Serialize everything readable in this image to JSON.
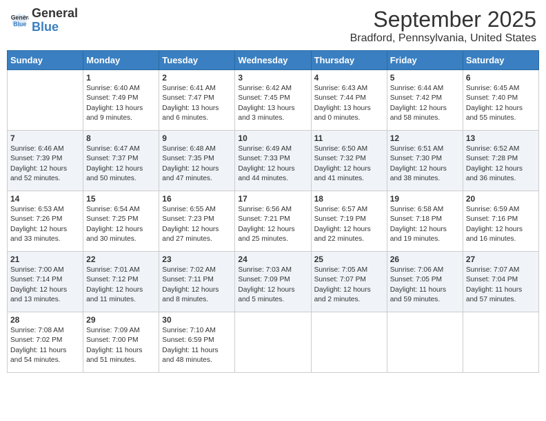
{
  "logo": {
    "line1": "General",
    "line2": "Blue"
  },
  "title": "September 2025",
  "location": "Bradford, Pennsylvania, United States",
  "days_of_week": [
    "Sunday",
    "Monday",
    "Tuesday",
    "Wednesday",
    "Thursday",
    "Friday",
    "Saturday"
  ],
  "weeks": [
    [
      {
        "day": "",
        "sunrise": "",
        "sunset": "",
        "daylight": ""
      },
      {
        "day": "1",
        "sunrise": "Sunrise: 6:40 AM",
        "sunset": "Sunset: 7:49 PM",
        "daylight": "Daylight: 13 hours and 9 minutes."
      },
      {
        "day": "2",
        "sunrise": "Sunrise: 6:41 AM",
        "sunset": "Sunset: 7:47 PM",
        "daylight": "Daylight: 13 hours and 6 minutes."
      },
      {
        "day": "3",
        "sunrise": "Sunrise: 6:42 AM",
        "sunset": "Sunset: 7:45 PM",
        "daylight": "Daylight: 13 hours and 3 minutes."
      },
      {
        "day": "4",
        "sunrise": "Sunrise: 6:43 AM",
        "sunset": "Sunset: 7:44 PM",
        "daylight": "Daylight: 13 hours and 0 minutes."
      },
      {
        "day": "5",
        "sunrise": "Sunrise: 6:44 AM",
        "sunset": "Sunset: 7:42 PM",
        "daylight": "Daylight: 12 hours and 58 minutes."
      },
      {
        "day": "6",
        "sunrise": "Sunrise: 6:45 AM",
        "sunset": "Sunset: 7:40 PM",
        "daylight": "Daylight: 12 hours and 55 minutes."
      }
    ],
    [
      {
        "day": "7",
        "sunrise": "Sunrise: 6:46 AM",
        "sunset": "Sunset: 7:39 PM",
        "daylight": "Daylight: 12 hours and 52 minutes."
      },
      {
        "day": "8",
        "sunrise": "Sunrise: 6:47 AM",
        "sunset": "Sunset: 7:37 PM",
        "daylight": "Daylight: 12 hours and 50 minutes."
      },
      {
        "day": "9",
        "sunrise": "Sunrise: 6:48 AM",
        "sunset": "Sunset: 7:35 PM",
        "daylight": "Daylight: 12 hours and 47 minutes."
      },
      {
        "day": "10",
        "sunrise": "Sunrise: 6:49 AM",
        "sunset": "Sunset: 7:33 PM",
        "daylight": "Daylight: 12 hours and 44 minutes."
      },
      {
        "day": "11",
        "sunrise": "Sunrise: 6:50 AM",
        "sunset": "Sunset: 7:32 PM",
        "daylight": "Daylight: 12 hours and 41 minutes."
      },
      {
        "day": "12",
        "sunrise": "Sunrise: 6:51 AM",
        "sunset": "Sunset: 7:30 PM",
        "daylight": "Daylight: 12 hours and 38 minutes."
      },
      {
        "day": "13",
        "sunrise": "Sunrise: 6:52 AM",
        "sunset": "Sunset: 7:28 PM",
        "daylight": "Daylight: 12 hours and 36 minutes."
      }
    ],
    [
      {
        "day": "14",
        "sunrise": "Sunrise: 6:53 AM",
        "sunset": "Sunset: 7:26 PM",
        "daylight": "Daylight: 12 hours and 33 minutes."
      },
      {
        "day": "15",
        "sunrise": "Sunrise: 6:54 AM",
        "sunset": "Sunset: 7:25 PM",
        "daylight": "Daylight: 12 hours and 30 minutes."
      },
      {
        "day": "16",
        "sunrise": "Sunrise: 6:55 AM",
        "sunset": "Sunset: 7:23 PM",
        "daylight": "Daylight: 12 hours and 27 minutes."
      },
      {
        "day": "17",
        "sunrise": "Sunrise: 6:56 AM",
        "sunset": "Sunset: 7:21 PM",
        "daylight": "Daylight: 12 hours and 25 minutes."
      },
      {
        "day": "18",
        "sunrise": "Sunrise: 6:57 AM",
        "sunset": "Sunset: 7:19 PM",
        "daylight": "Daylight: 12 hours and 22 minutes."
      },
      {
        "day": "19",
        "sunrise": "Sunrise: 6:58 AM",
        "sunset": "Sunset: 7:18 PM",
        "daylight": "Daylight: 12 hours and 19 minutes."
      },
      {
        "day": "20",
        "sunrise": "Sunrise: 6:59 AM",
        "sunset": "Sunset: 7:16 PM",
        "daylight": "Daylight: 12 hours and 16 minutes."
      }
    ],
    [
      {
        "day": "21",
        "sunrise": "Sunrise: 7:00 AM",
        "sunset": "Sunset: 7:14 PM",
        "daylight": "Daylight: 12 hours and 13 minutes."
      },
      {
        "day": "22",
        "sunrise": "Sunrise: 7:01 AM",
        "sunset": "Sunset: 7:12 PM",
        "daylight": "Daylight: 12 hours and 11 minutes."
      },
      {
        "day": "23",
        "sunrise": "Sunrise: 7:02 AM",
        "sunset": "Sunset: 7:11 PM",
        "daylight": "Daylight: 12 hours and 8 minutes."
      },
      {
        "day": "24",
        "sunrise": "Sunrise: 7:03 AM",
        "sunset": "Sunset: 7:09 PM",
        "daylight": "Daylight: 12 hours and 5 minutes."
      },
      {
        "day": "25",
        "sunrise": "Sunrise: 7:05 AM",
        "sunset": "Sunset: 7:07 PM",
        "daylight": "Daylight: 12 hours and 2 minutes."
      },
      {
        "day": "26",
        "sunrise": "Sunrise: 7:06 AM",
        "sunset": "Sunset: 7:05 PM",
        "daylight": "Daylight: 11 hours and 59 minutes."
      },
      {
        "day": "27",
        "sunrise": "Sunrise: 7:07 AM",
        "sunset": "Sunset: 7:04 PM",
        "daylight": "Daylight: 11 hours and 57 minutes."
      }
    ],
    [
      {
        "day": "28",
        "sunrise": "Sunrise: 7:08 AM",
        "sunset": "Sunset: 7:02 PM",
        "daylight": "Daylight: 11 hours and 54 minutes."
      },
      {
        "day": "29",
        "sunrise": "Sunrise: 7:09 AM",
        "sunset": "Sunset: 7:00 PM",
        "daylight": "Daylight: 11 hours and 51 minutes."
      },
      {
        "day": "30",
        "sunrise": "Sunrise: 7:10 AM",
        "sunset": "Sunset: 6:59 PM",
        "daylight": "Daylight: 11 hours and 48 minutes."
      },
      {
        "day": "",
        "sunrise": "",
        "sunset": "",
        "daylight": ""
      },
      {
        "day": "",
        "sunrise": "",
        "sunset": "",
        "daylight": ""
      },
      {
        "day": "",
        "sunrise": "",
        "sunset": "",
        "daylight": ""
      },
      {
        "day": "",
        "sunrise": "",
        "sunset": "",
        "daylight": ""
      }
    ]
  ]
}
